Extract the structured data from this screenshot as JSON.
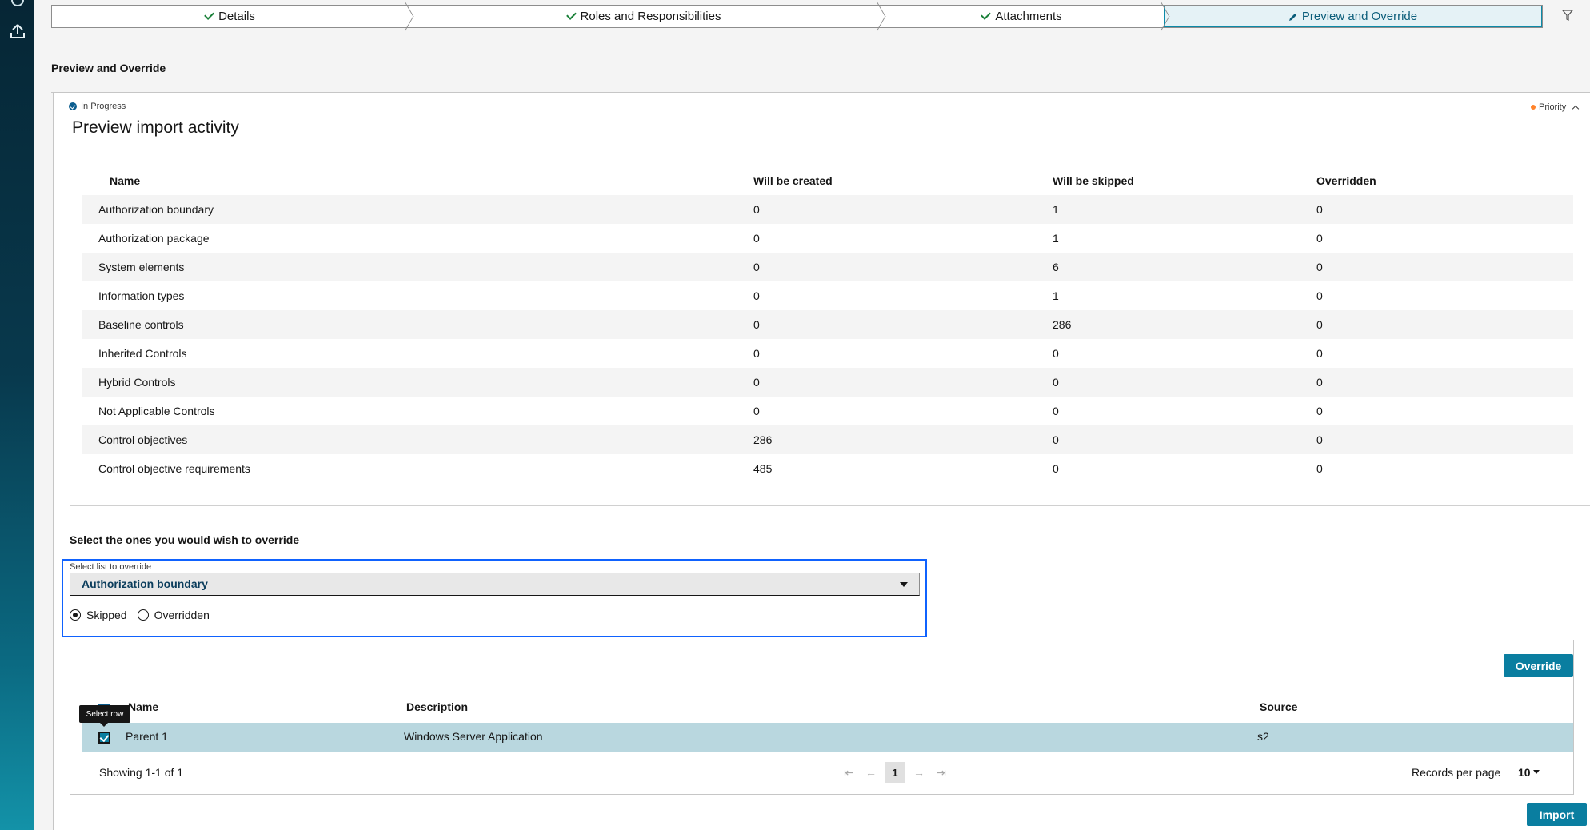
{
  "stepper": {
    "steps": [
      {
        "label": "Details",
        "done": true
      },
      {
        "label": "Roles and Responsibilities",
        "done": true
      },
      {
        "label": "Attachments",
        "done": true
      },
      {
        "label": "Preview and Override",
        "active": true
      }
    ]
  },
  "page": {
    "section_title": "Preview and Override",
    "status": "In Progress",
    "priority": "Priority",
    "title": "Preview import activity"
  },
  "summary": {
    "headers": [
      "Name",
      "Will be created",
      "Will be skipped",
      "Overridden"
    ],
    "rows": [
      [
        "Authorization boundary",
        "0",
        "1",
        "0"
      ],
      [
        "Authorization package",
        "0",
        "1",
        "0"
      ],
      [
        "System elements",
        "0",
        "6",
        "0"
      ],
      [
        "Information types",
        "0",
        "1",
        "0"
      ],
      [
        "Baseline controls",
        "0",
        "286",
        "0"
      ],
      [
        "Inherited Controls",
        "0",
        "0",
        "0"
      ],
      [
        "Hybrid Controls",
        "0",
        "0",
        "0"
      ],
      [
        "Not Applicable Controls",
        "0",
        "0",
        "0"
      ],
      [
        "Control objectives",
        "286",
        "0",
        "0"
      ],
      [
        "Control objective requirements",
        "485",
        "0",
        "0"
      ]
    ]
  },
  "override": {
    "title": "Select the ones you would wish to override",
    "select_label": "Select list to override",
    "select_value": "Authorization boundary",
    "radio_skipped": "Skipped",
    "radio_overridden": "Overridden",
    "override_button": "Override",
    "tooltip": "Select row",
    "headers": {
      "name": "Name",
      "description": "Description",
      "source": "Source"
    },
    "rows": [
      {
        "name": "Parent 1",
        "description": "Windows Server Application",
        "source": "s2"
      }
    ],
    "showing": "Showing 1-1 of 1",
    "page_number": "1",
    "records_per_page_label": "Records per page",
    "records_per_page": "10"
  },
  "footer": {
    "import_button": "Import"
  },
  "colors": {
    "accent": "#0a7ea0",
    "focus": "#0f62fe",
    "selected_row": "#b9d7df",
    "priority_dot": "#ff832b"
  }
}
